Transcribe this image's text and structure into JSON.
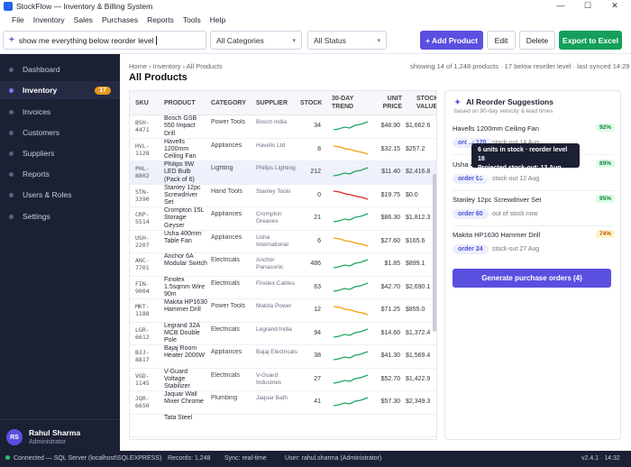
{
  "window": {
    "title": "StockFlow — Inventory & Billing System"
  },
  "menu": [
    "File",
    "Inventory",
    "Sales",
    "Purchases",
    "Reports",
    "Tools",
    "Help"
  ],
  "toolbar": {
    "search_value": "show me everything below reorder level",
    "category_filter": "All Categories",
    "status_filter": "All Status",
    "add_label": "+ Add Product",
    "edit_label": "Edit",
    "delete_label": "Delete",
    "export_label": "Export to Excel"
  },
  "sidebar": {
    "items": [
      {
        "label": "Dashboard"
      },
      {
        "label": "Inventory",
        "badge": "17"
      },
      {
        "label": "Invoices"
      },
      {
        "label": "Customers"
      },
      {
        "label": "Suppliers"
      },
      {
        "label": "Reports"
      },
      {
        "label": "Users & Roles"
      },
      {
        "label": "Settings"
      }
    ],
    "user": {
      "initials": "RS",
      "name": "Rahul Sharma",
      "role": "Administrator"
    }
  },
  "main": {
    "breadcrumb": "Home › Inventory › All Products",
    "meta": "showing 14 of 1,248 products  ·  17 below reorder level  ·  last synced 14:29",
    "title": "All Products",
    "columns": [
      "SKU",
      "PRODUCT",
      "CATEGORY",
      "SUPPLIER",
      "STOCK",
      "30-DAY TREND",
      "UNIT PRICE",
      "STOCK VALUE"
    ],
    "rows": [
      {
        "sku": "BSH-4471",
        "product": "Bosch GSB 550 Impact Drill",
        "category": "Power Tools",
        "supplier": "Bosch India",
        "stock": "34",
        "price": "$48.90",
        "value": "$1,662.6",
        "trend": "up"
      },
      {
        "sku": "HVL-1128",
        "product": "Havells 1200mm Ceiling Fan",
        "category": "Appliances",
        "supplier": "Havells Ltd",
        "stock": "8",
        "price": "$32.15",
        "value": "$257.2",
        "trend": "down"
      },
      {
        "sku": "PHL-8802",
        "product": "Philips 9W LED Bulb (Pack of 6)",
        "category": "Lighting",
        "supplier": "Philips Lighting",
        "stock": "212",
        "price": "$11.40",
        "value": "$2,416.8",
        "trend": "up"
      },
      {
        "sku": "STN-3390",
        "product": "Stanley 12pc Screwdriver Set",
        "category": "Hand Tools",
        "supplier": "Stanley Tools",
        "stock": "0",
        "price": "$19.75",
        "value": "$0.0",
        "trend": "critical"
      },
      {
        "sku": "CRP-5514",
        "product": "Crompton 15L Storage Geyser",
        "category": "Appliances",
        "supplier": "Crompton Greaves",
        "stock": "21",
        "price": "$86.30",
        "value": "$1,812.3",
        "trend": "up"
      },
      {
        "sku": "USH-2207",
        "product": "Usha 400mm Table Fan",
        "category": "Appliances",
        "supplier": "Usha International",
        "stock": "6",
        "price": "$27.60",
        "value": "$165.6",
        "trend": "down"
      },
      {
        "sku": "ANC-7701",
        "product": "Anchor 6A Modular Switch",
        "category": "Electricals",
        "supplier": "Anchor Panasonic",
        "stock": "486",
        "price": "$1.85",
        "value": "$899.1",
        "trend": "up"
      },
      {
        "sku": "FIN-9004",
        "product": "Finolex 1.5sqmm Wire 90m",
        "category": "Electricals",
        "supplier": "Finolex Cables",
        "stock": "63",
        "price": "$42.70",
        "value": "$2,690.1",
        "trend": "up"
      },
      {
        "sku": "MKT-1188",
        "product": "Makita HP1630 Hammer Drill",
        "category": "Power Tools",
        "supplier": "Makita Power",
        "stock": "12",
        "price": "$71.25",
        "value": "$855.0",
        "trend": "down"
      },
      {
        "sku": "LGR-6612",
        "product": "Legrand 32A MCB Double Pole",
        "category": "Electricals",
        "supplier": "Legrand India",
        "stock": "94",
        "price": "$14.60",
        "value": "$1,372.4",
        "trend": "up"
      },
      {
        "sku": "BJJ-8817",
        "product": "Bajaj Room Heater 2000W",
        "category": "Appliances",
        "supplier": "Bajaj Electricals",
        "stock": "38",
        "price": "$41.30",
        "value": "$1,569.4",
        "trend": "up"
      },
      {
        "sku": "VGD-1145",
        "product": "V-Guard Voltage Stabilizer",
        "category": "Electricals",
        "supplier": "V-Guard Industries",
        "stock": "27",
        "price": "$52.70",
        "value": "$1,422.9",
        "trend": "up"
      },
      {
        "sku": "JQR-6650",
        "product": "Jaquar Wall Mixer Chrome",
        "category": "Plumbing",
        "supplier": "Jaquar Bath",
        "stock": "41",
        "price": "$57.30",
        "value": "$2,349.3",
        "trend": "up"
      },
      {
        "sku": "",
        "product": "Tata Steel",
        "category": "",
        "supplier": "",
        "stock": "",
        "price": "",
        "value": "",
        "trend": "none"
      }
    ]
  },
  "ai_panel": {
    "title": "AI Reorder Suggestions",
    "subtitle": "based on 90-day velocity & lead times",
    "suggestions": [
      {
        "name": "Havells 1200mm Ceiling Fan",
        "pct": "92%",
        "order": "order 120",
        "out": "stock-out 14 Aug",
        "pct_bg": "#dcfce7",
        "pct_fg": "#15803d"
      },
      {
        "name": "Usha 400mm Table Fan",
        "pct": "89%",
        "order": "order 90",
        "out": "stock-out 12 Aug",
        "pct_bg": "#dcfce7",
        "pct_fg": "#15803d"
      },
      {
        "name": "Stanley 12pc Screwdriver Set",
        "pct": "95%",
        "order": "order 60",
        "out": "out of stock now",
        "pct_bg": "#dcfce7",
        "pct_fg": "#15803d"
      },
      {
        "name": "Makita HP1630 Hammer Drill",
        "pct": "74%",
        "order": "order 24",
        "out": "stock-out 27 Aug",
        "pct_bg": "#fef3c7",
        "pct_fg": "#b45309"
      }
    ],
    "generate_label": "Generate purchase orders (4)",
    "tooltip_line1": "6 units in stock  ·  reorder level 18",
    "tooltip_line2": "Projected stock-out: 12 Aug 2026"
  },
  "status": {
    "connection": "Connected — SQL Server (localhost\\SQLEXPRESS)",
    "records": "Records: 1,248",
    "sync": "Sync: real-time",
    "user": "User: rahul.sharma (Administrator)",
    "version": "v2.4.1  ·  14:32"
  },
  "colors": {
    "accent": "#5b4fe0",
    "export": "#14a05a",
    "sidebar": "#1c2033",
    "trend_up": "#1fa463",
    "trend_down": "#f59e0b",
    "trend_critical": "#dc2626"
  }
}
